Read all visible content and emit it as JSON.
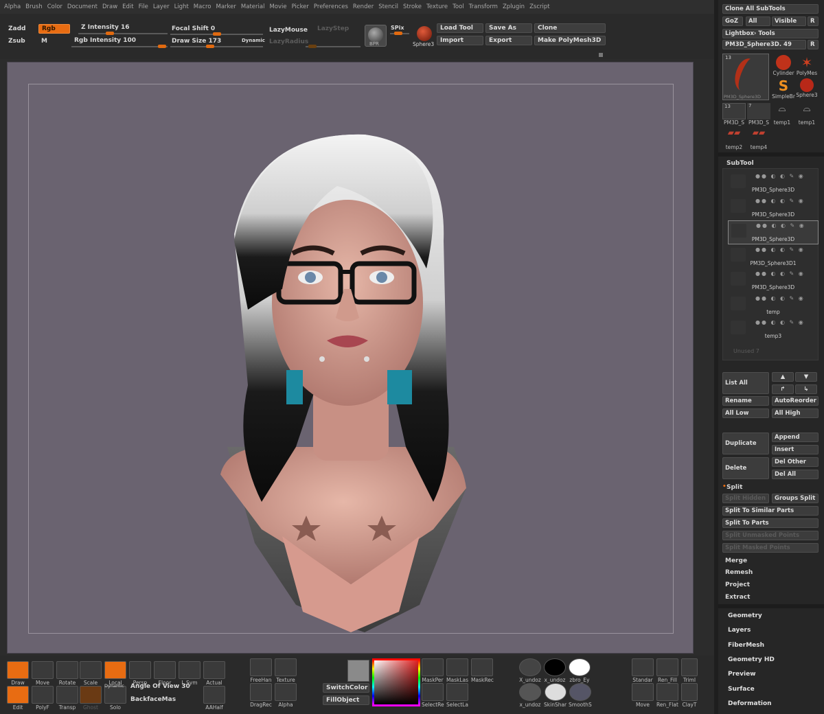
{
  "menu": [
    "Alpha",
    "Brush",
    "Color",
    "Document",
    "Draw",
    "Edit",
    "File",
    "Layer",
    "Light",
    "Macro",
    "Marker",
    "Material",
    "Movie",
    "Picker",
    "Preferences",
    "Render",
    "Stencil",
    "Stroke",
    "Texture",
    "Tool",
    "Transform",
    "Zplugin",
    "Zscript"
  ],
  "top": {
    "zadd": "Zadd",
    "zsub": "Zsub",
    "rgb": "Rgb",
    "m": "M",
    "z_intensity": "Z Intensity 16",
    "rgb_intensity": "Rgb Intensity 100",
    "focal_shift": "Focal Shift 0",
    "draw_size": "Draw Size 173",
    "dynamic": "Dynamic",
    "lazymouse": "LazyMouse",
    "lazystep": "LazyStep",
    "lazyradius": "LazyRadius",
    "bpr": "BPR",
    "spix": "SPix",
    "sphere": "Sphere3",
    "load_tool": "Load Tool",
    "save_as": "Save As",
    "clone": "Clone",
    "import": "Import",
    "export": "Export",
    "make_polymesh": "Make PolyMesh3D"
  },
  "right": {
    "clone_all": "Clone All SubTools",
    "goz": "GoZ",
    "all": "All",
    "visible": "Visible",
    "r": "R",
    "lightbox_tools": "Lightbox› Tools",
    "current_tool": "PM3D_Sphere3D. 49",
    "tool_thumbs": [
      {
        "label": "PM3D_Sphere3D",
        "count": "13"
      },
      {
        "label": "Cylinder"
      },
      {
        "label": "PolyMes"
      },
      {
        "label": "SimpleBr"
      },
      {
        "label": "Sphere3"
      },
      {
        "label": "PM3D_S",
        "count": "13"
      },
      {
        "label": "PM3D_S",
        "count": "7"
      },
      {
        "label": "temp1"
      },
      {
        "label": "temp1"
      },
      {
        "label": "temp2"
      },
      {
        "label": "temp4"
      }
    ],
    "subtool_title": "SubTool",
    "subtools": [
      "PM3D_Sphere3D",
      "PM3D_Sphere3D",
      "PM3D_Sphere3D",
      "PM3D_Sphere3D1",
      "PM3D_Sphere3D",
      "temp",
      "temp3"
    ],
    "unused": "Unused 7",
    "list_all": "List All",
    "rename": "Rename",
    "autoreorder": "AutoReorder",
    "all_low": "All Low",
    "all_high": "All High",
    "duplicate": "Duplicate",
    "append": "Append",
    "insert": "Insert",
    "delete": "Delete",
    "del_other": "Del Other",
    "del_all": "Del All",
    "split": "Split",
    "split_hidden": "Split Hidden",
    "groups_split": "Groups Split",
    "split_similar": "Split To Similar Parts",
    "split_parts": "Split To Parts",
    "split_unmasked": "Split Unmasked Points",
    "split_masked": "Split Masked Points",
    "merge": "Merge",
    "remesh": "Remesh",
    "project": "Project",
    "extract": "Extract",
    "sections": [
      "Geometry",
      "Layers",
      "FiberMesh",
      "Geometry HD",
      "Preview",
      "Surface",
      "Deformation"
    ]
  },
  "dock": {
    "draw": "Draw",
    "move": "Move",
    "rotate": "Rotate",
    "scale": "Scale",
    "local": "Local",
    "persp": "Persp",
    "floor": "Floor",
    "lsym": "L.Sym",
    "actual": "Actual",
    "edit": "Edit",
    "polyf": "PolyF",
    "transp": "Transp",
    "ghost": "Ghost",
    "solo": "Solo",
    "dynamic": "Dynamic",
    "angle_of_view": "Angle Of View 30",
    "backfacemask": "BackfaceMas",
    "aahalf": "AAHalf",
    "freehand": "FreeHan",
    "texture": "Texture",
    "dragrect": "DragRec",
    "alpha": "Alpha",
    "switchcolor": "SwitchColor",
    "fillobject": "FillObject",
    "maskper": "MaskPer",
    "masklas": "MaskLas",
    "maskrec": "MaskRec",
    "selectre": "SelectRe",
    "selectla": "SelectLa",
    "x_undo1": "X_undoz",
    "x_undo2": "x_undoz",
    "zbro_ey": "zbro_Ey",
    "x_undo3": "x_undoz",
    "skinsha": "SkinShar",
    "smooths": "SmoothS",
    "standard": "Standar",
    "ren_fill": "Ren_Fill",
    "trim": "TrimI",
    "move2": "Move",
    "ren_flat": "Ren_Flat",
    "clay": "ClayT"
  },
  "colors": {
    "accent": "#e86c12",
    "viewport_bg": "#6a6370",
    "panel_bg": "#262626"
  }
}
